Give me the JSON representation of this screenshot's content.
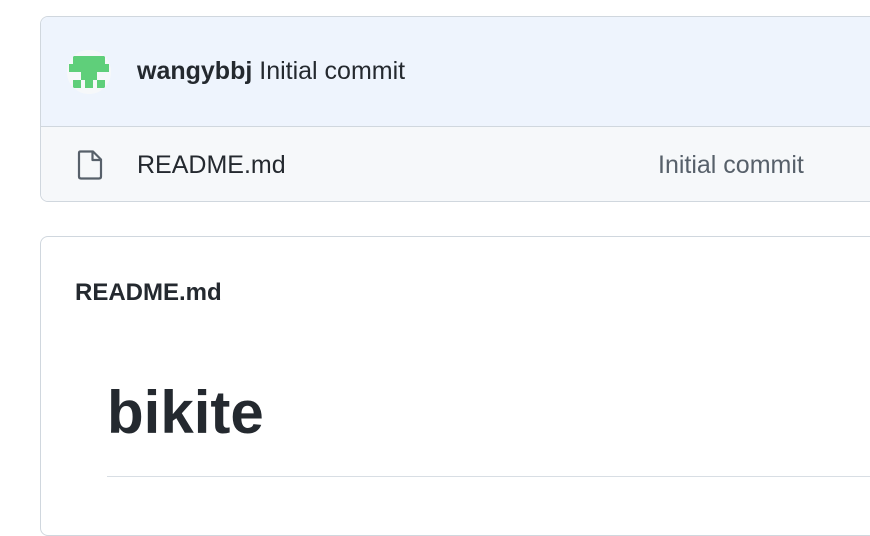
{
  "commit": {
    "author": "wangybbj",
    "message": "Initial commit"
  },
  "files": [
    {
      "name": "README.md",
      "icon": "file-icon",
      "commit_message": "Initial commit"
    }
  ],
  "readme": {
    "header": "README.md",
    "title": "bikite"
  },
  "colors": {
    "commit_header_bg": "#eef4fd",
    "file_row_bg": "#f6f8fa",
    "border": "#d0d7de",
    "text": "#24292f",
    "muted_text": "#57606a",
    "avatar_green": "#5fcf7a"
  }
}
